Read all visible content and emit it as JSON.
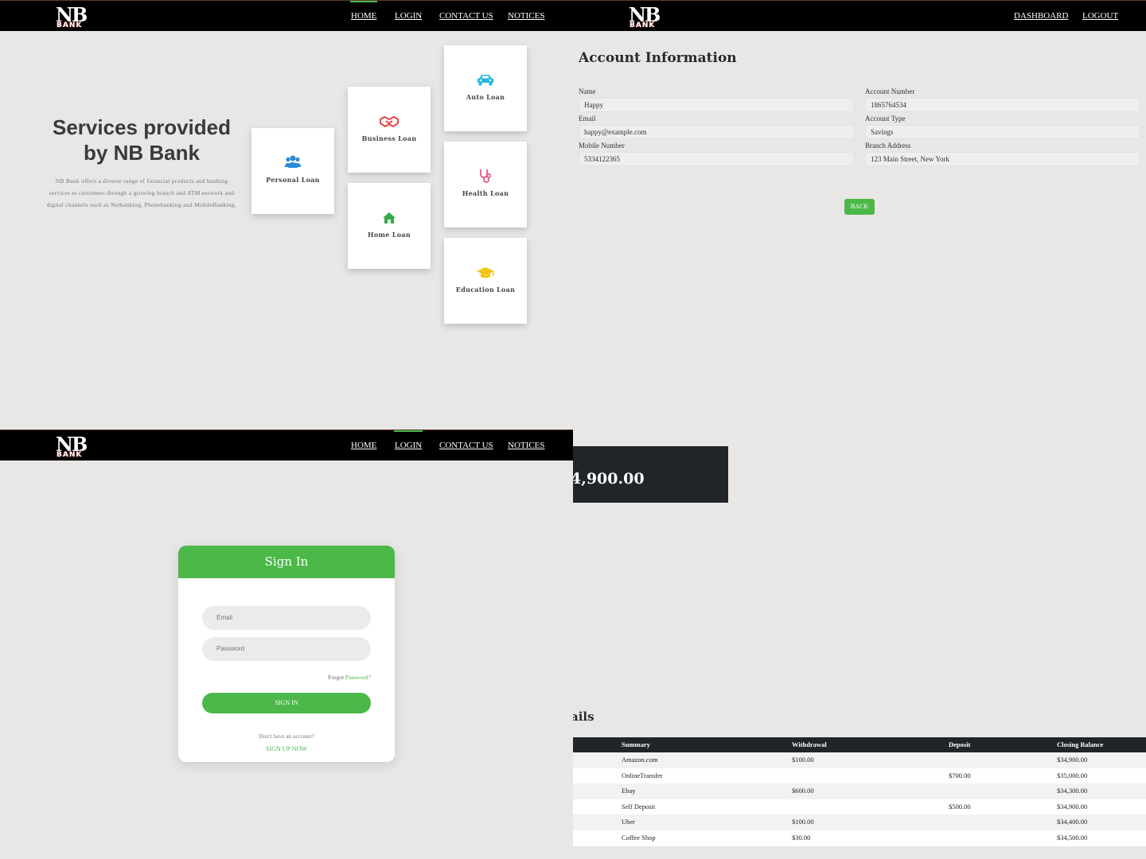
{
  "logo": {
    "nb": "NB",
    "bank": "BANK"
  },
  "public_nav": {
    "home": "HOME",
    "login": "LOGIN",
    "contact": "CONTACT US",
    "notices": "NOTICES"
  },
  "user_nav": {
    "dashboard": "DASHBOARD",
    "logout": "LOGOUT"
  },
  "home": {
    "title": "Services provided by NB Bank",
    "description": "NB Bank offers a diverse range of financial products and banking services to customers through a growing branch and ATM network and digital channels such as Netbanking, Phonebanking and MobileBanking.",
    "cards": [
      {
        "label": "Personal Loan",
        "icon": "users-icon",
        "color": "#2a8ad8"
      },
      {
        "label": "Business Loan",
        "icon": "handshake-icon",
        "color": "#e64545"
      },
      {
        "label": "Home Loan",
        "icon": "home-icon",
        "color": "#3aa84a"
      },
      {
        "label": "Auto Loan",
        "icon": "car-icon",
        "color": "#22b7e0"
      },
      {
        "label": "Health Loan",
        "icon": "stethoscope-icon",
        "color": "#e8457a"
      },
      {
        "label": "Education Loan",
        "icon": "graduation-cap-icon",
        "color": "#f2c40f"
      }
    ]
  },
  "account": {
    "title": "Account Information",
    "fields": {
      "name_label": "Name",
      "name_value": "Happy",
      "email_label": "Email",
      "email_value": "happy@example.com",
      "mobile_label": "Mobile Number",
      "mobile_value": "5334122365",
      "number_label": "Account Number",
      "number_value": "1865764534",
      "type_label": "Account Type",
      "type_value": "Savings",
      "branch_label": "Branch Address",
      "branch_value": "123 Main Street, New York"
    },
    "back_label": "BACK"
  },
  "signin": {
    "title": "Sign In",
    "email_placeholder": "Email",
    "password_placeholder": "Password",
    "forgot_prefix": "Forgot",
    "forgot_link": "Password?",
    "button": "SIGN IN",
    "no_account": "Don't have an account?",
    "signup": "SIGN UP NOW"
  },
  "dashboard": {
    "balance": "4,900.00",
    "details_title": "ails",
    "columns": [
      "Summary",
      "Withdrawal",
      "Deposit",
      "Closing Balance"
    ],
    "rows": [
      [
        "Amazon.com",
        "$100.00",
        "",
        "$34,900.00"
      ],
      [
        "OnlineTransfer",
        "",
        "$700.00",
        "$35,000.00"
      ],
      [
        "Ebay",
        "$600.00",
        "",
        "$34,300.00"
      ],
      [
        "Self Deposit",
        "",
        "$500.00",
        "$34,900.00"
      ],
      [
        "Uber",
        "$100.00",
        "",
        "$34,400.00"
      ],
      [
        "Coffee Shop",
        "$30.00",
        "",
        "$34,500.00"
      ]
    ]
  },
  "colors": {
    "accent": "#4db84a",
    "navbar": "#000000",
    "dark": "#212529",
    "background": "#e9e7e5"
  }
}
